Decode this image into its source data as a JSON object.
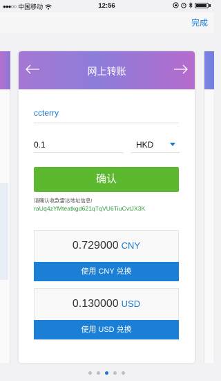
{
  "status_bar": {
    "carrier": "中国移动",
    "time": "12:56"
  },
  "top_bar": {
    "done_label": "完成"
  },
  "card": {
    "title": "网上转账",
    "recipient": "ccterry",
    "amount": "0.1",
    "currency": "HKD",
    "confirm_label": "确认",
    "hint": "请确认收款雷达地址信息!",
    "address": "raUq4zYMteatkgd621qTqVU6TiuCvtJX3K",
    "conversions": [
      {
        "value": "0.729000",
        "currency": "CNY",
        "button_label": "使用 CNY 兑换"
      },
      {
        "value": "0.130000",
        "currency": "USD",
        "button_label": "使用 USD 兑换"
      }
    ]
  },
  "pager": {
    "count": 5,
    "active_index": 3
  },
  "colors": {
    "accent_blue": "#1a78d0",
    "confirm_green": "#5cb92f",
    "header_purple": "#9a7ad7"
  }
}
